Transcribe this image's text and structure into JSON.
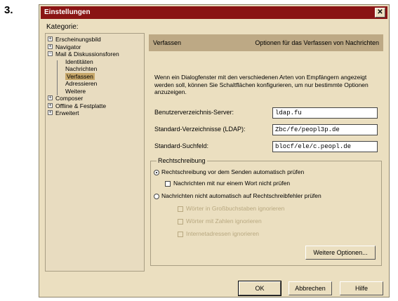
{
  "step_number": "3.",
  "window": {
    "title": "Einstellungen",
    "close_glyph": "✕"
  },
  "categories_label": "Kategorie:",
  "tree": {
    "items": [
      {
        "label": "Erscheinungsbild",
        "level": 0,
        "expander": "+"
      },
      {
        "label": "Navigator",
        "level": 0,
        "expander": "+"
      },
      {
        "label": "Mail & Diskussionsforen",
        "level": 0,
        "expander": "−"
      },
      {
        "label": "Identitäten",
        "level": 1
      },
      {
        "label": "Nachrichten",
        "level": 1
      },
      {
        "label": "Verfassen",
        "level": 1,
        "selected": true
      },
      {
        "label": "Adressieren",
        "level": 1
      },
      {
        "label": "Weitere",
        "level": 1
      },
      {
        "label": "Composer",
        "level": 0,
        "expander": "+"
      },
      {
        "label": "Offline & Festplatte",
        "level": 0,
        "expander": "+"
      },
      {
        "label": "Erweitert",
        "level": 0,
        "expander": "+"
      }
    ]
  },
  "panel": {
    "header_left": "Verfassen",
    "header_right": "Optionen für das Verfassen von Nachrichten",
    "description": "Wenn ein Dialogfenster mit den verschiedenen Arten von Empfängern angezeigt werden soll, können Sie Schaltflächen konfigurieren, um nur bestimmte Optionen anzuzeigen.",
    "fields": [
      {
        "label": "Benutzerverzeichnis-Server:",
        "value": "ldap.fu"
      },
      {
        "label": "Standard-Verzeichnisse (LDAP):",
        "value": "Zbc/fe/peopl3p.de"
      },
      {
        "label": "Standard-Suchfeld:",
        "value": "blocf/ele/c.peopl.de"
      }
    ],
    "group_label": "Rechtschreibung",
    "radio1": "Rechtschreibung vor dem Senden automatisch prüfen",
    "check1": "Nachrichten mit nur einem Wort nicht prüfen",
    "radio2": "Nachrichten nicht automatisch auf Rechtschreibfehler prüfen",
    "check2": "Wörter in Großbuchstaben ignorieren",
    "check3": "Wörter mit Zahlen ignorieren",
    "check4": "Internetadressen ignorieren",
    "weitere_button": "Weitere Optionen..."
  },
  "buttons": {
    "ok": "OK",
    "cancel": "Abbrechen",
    "help": "Hilfe"
  }
}
